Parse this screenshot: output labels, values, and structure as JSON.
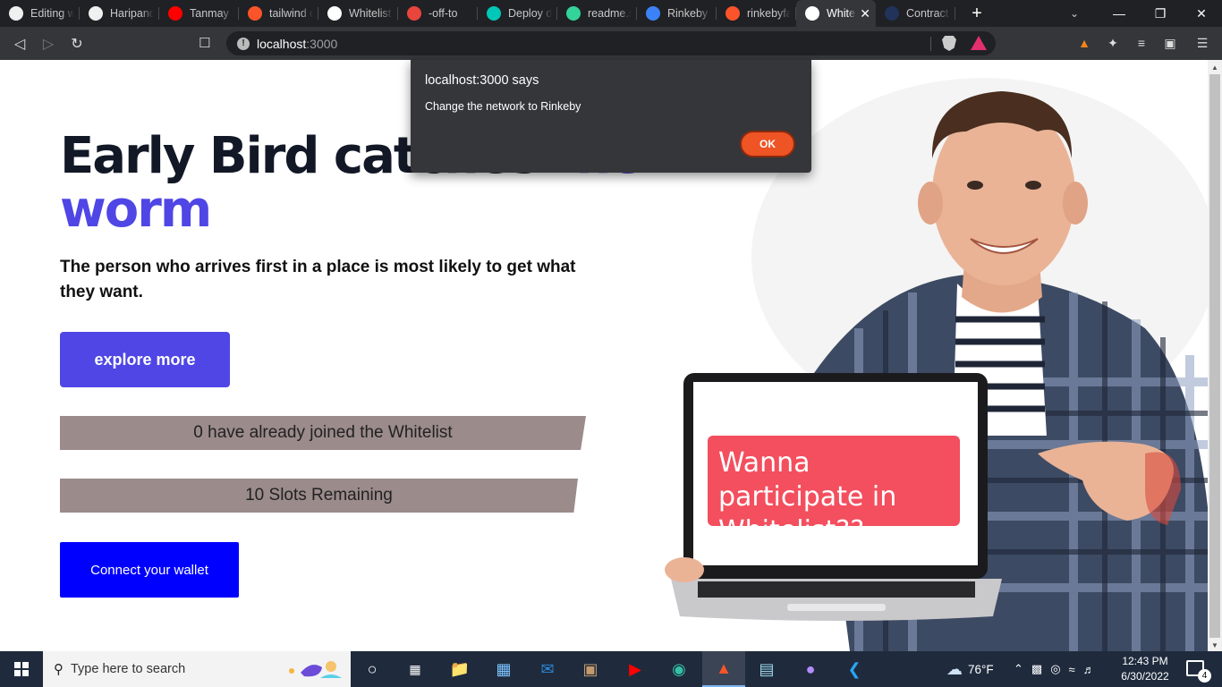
{
  "browser": {
    "tabs": [
      {
        "title": "Editing w",
        "icon": "github-icon",
        "color": "#f0f0f0"
      },
      {
        "title": "Haripande",
        "icon": "github-icon",
        "color": "#f0f0f0"
      },
      {
        "title": "Tanmay B",
        "icon": "youtube-icon",
        "color": "#ff0000"
      },
      {
        "title": "tailwind d",
        "icon": "brave-icon",
        "color": "#fb542b"
      },
      {
        "title": "Whitelist",
        "icon": "vercel-icon",
        "color": "#ffffff"
      },
      {
        "title": "-off-to",
        "icon": "chrome-icon",
        "color": "#e8453c"
      },
      {
        "title": "Deploy de",
        "icon": "deploy-icon",
        "color": "#00c7b7"
      },
      {
        "title": "readme.so",
        "icon": "readme-icon",
        "color": "#34d399"
      },
      {
        "title": "Rinkeby F",
        "icon": "rinkeby-icon",
        "color": "#3b82f6"
      },
      {
        "title": "rinkebyfa",
        "icon": "brave-icon",
        "color": "#fb542b"
      },
      {
        "title": "White",
        "icon": "vercel-icon",
        "color": "#ffffff",
        "active": true
      },
      {
        "title": "Contract /",
        "icon": "etherscan-icon",
        "color": "#21325b"
      }
    ],
    "url_host": "localhost",
    "url_port": ":3000"
  },
  "alert": {
    "title": "localhost:3000 says",
    "message": "Change the network to Rinkeby",
    "ok_label": "OK"
  },
  "hero": {
    "headline_dark": "Early Bird catches ",
    "headline_accent": "the worm",
    "headline_line2": "worm",
    "subheading": "The person who arrives first in a place is most likely to get what they want.",
    "explore_label": "explore more",
    "joined_text": "0 have already joined the Whitelist",
    "slots_text": "10 Slots Remaining",
    "connect_label": "Connect your wallet",
    "laptop_text": "Wanna participate in Whitelist??"
  },
  "colors": {
    "accent": "#4f46e5",
    "connect_blue": "#0000ff",
    "banner_gray": "#9b8b8b",
    "bubble_red": "#f34f5e",
    "alert_ok": "#ef5424"
  },
  "taskbar": {
    "search_placeholder": "Type here to search",
    "weather": "76°F",
    "time": "12:43 PM",
    "date": "6/30/2022",
    "notifications": "4"
  }
}
